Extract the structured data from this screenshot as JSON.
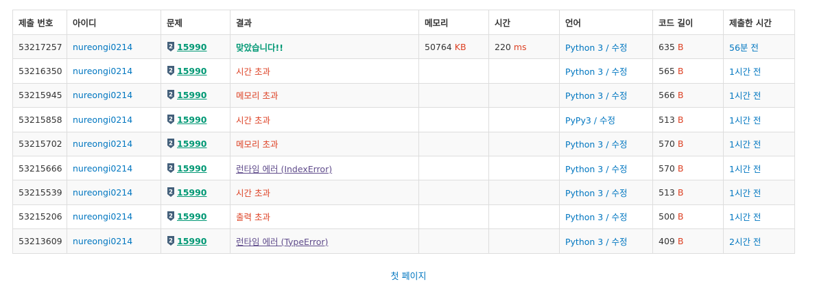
{
  "headers": {
    "submission_id": "제출 번호",
    "user": "아이디",
    "problem": "문제",
    "result": "결과",
    "memory": "메모리",
    "time": "시간",
    "language": "언어",
    "code_length": "코드 길이",
    "submitted_at": "제출한 시간"
  },
  "units": {
    "memory": "KB",
    "time": "ms",
    "bytes": "B"
  },
  "edit_label": "수정",
  "colors": {
    "link": "#0076c0",
    "accepted": "#009874",
    "wrong": "#dd4124",
    "runtime_error": "#5f4b8b",
    "tier_badge": "#435f7a"
  },
  "tier_icon": "silver-tier-badge-icon",
  "rows": [
    {
      "id": "53217257",
      "user": "nureongi0214",
      "tier": "2",
      "problem": "15990",
      "result": "맞았습니다!!",
      "result_kind": "ac",
      "memory": "50764",
      "time": "220",
      "language": "Python 3",
      "code_len": "635",
      "submitted": "56분 전"
    },
    {
      "id": "53216350",
      "user": "nureongi0214",
      "tier": "2",
      "problem": "15990",
      "result": "시간 초과",
      "result_kind": "wrong",
      "memory": "",
      "time": "",
      "language": "Python 3",
      "code_len": "565",
      "submitted": "1시간 전"
    },
    {
      "id": "53215945",
      "user": "nureongi0214",
      "tier": "2",
      "problem": "15990",
      "result": "메모리 초과",
      "result_kind": "wrong",
      "memory": "",
      "time": "",
      "language": "Python 3",
      "code_len": "566",
      "submitted": "1시간 전"
    },
    {
      "id": "53215858",
      "user": "nureongi0214",
      "tier": "2",
      "problem": "15990",
      "result": "시간 초과",
      "result_kind": "wrong",
      "memory": "",
      "time": "",
      "language": "PyPy3",
      "code_len": "513",
      "submitted": "1시간 전"
    },
    {
      "id": "53215702",
      "user": "nureongi0214",
      "tier": "2",
      "problem": "15990",
      "result": "메모리 초과",
      "result_kind": "wrong",
      "memory": "",
      "time": "",
      "language": "Python 3",
      "code_len": "570",
      "submitted": "1시간 전"
    },
    {
      "id": "53215666",
      "user": "nureongi0214",
      "tier": "2",
      "problem": "15990",
      "result": "런타임 에러 (IndexError)",
      "result_kind": "rte",
      "memory": "",
      "time": "",
      "language": "Python 3",
      "code_len": "570",
      "submitted": "1시간 전"
    },
    {
      "id": "53215539",
      "user": "nureongi0214",
      "tier": "2",
      "problem": "15990",
      "result": "시간 초과",
      "result_kind": "wrong",
      "memory": "",
      "time": "",
      "language": "Python 3",
      "code_len": "513",
      "submitted": "1시간 전"
    },
    {
      "id": "53215206",
      "user": "nureongi0214",
      "tier": "2",
      "problem": "15990",
      "result": "출력 초과",
      "result_kind": "wrong",
      "memory": "",
      "time": "",
      "language": "Python 3",
      "code_len": "500",
      "submitted": "1시간 전"
    },
    {
      "id": "53213609",
      "user": "nureongi0214",
      "tier": "2",
      "problem": "15990",
      "result": "런타임 에러 (TypeError)",
      "result_kind": "rte",
      "memory": "",
      "time": "",
      "language": "Python 3",
      "code_len": "409",
      "submitted": "2시간 전"
    }
  ],
  "pagination": {
    "first_page": "첫 페이지"
  }
}
